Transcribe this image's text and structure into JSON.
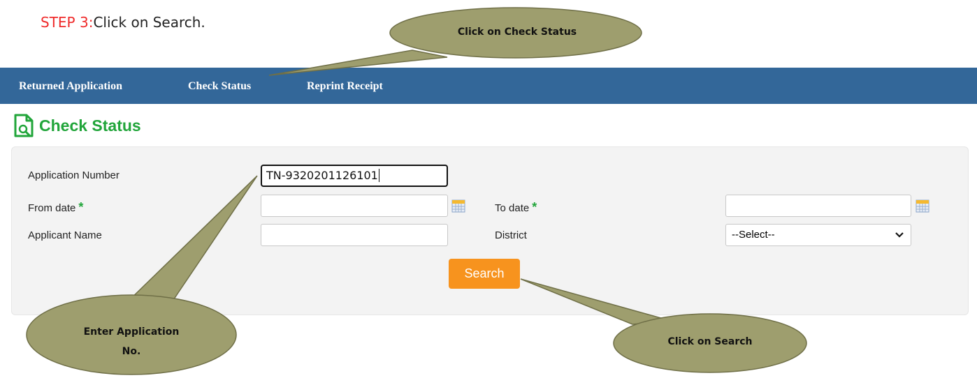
{
  "instruction": {
    "step_label": "STEP 3:",
    "text": "Click on Search."
  },
  "nav": {
    "items": [
      "Returned Application",
      "Check Status",
      "Reprint Receipt"
    ]
  },
  "page": {
    "title": "Check Status"
  },
  "form": {
    "application_number_label": "Application Number",
    "application_number_value": "TN-9320201126101",
    "from_date_label": "From date",
    "to_date_label": "To date",
    "required_marker": "*",
    "applicant_name_label": "Applicant Name",
    "district_label": "District",
    "district_value": "--Select--",
    "search_label": "Search"
  },
  "callouts": {
    "check_status": "Click on Check Status",
    "enter_app_no_line1": "Enter Application",
    "enter_app_no_line2": "No.",
    "search": "Click on Search"
  },
  "colors": {
    "nav_bg": "#336799",
    "title_green": "#21a53a",
    "button_orange": "#f7931e",
    "callout_fill": "#9e9e6e",
    "step_red": "#ef2b2b"
  }
}
